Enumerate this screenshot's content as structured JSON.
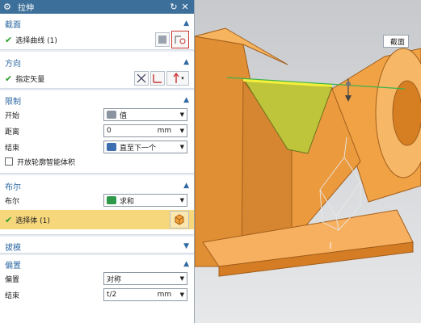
{
  "dialog": {
    "title": "拉伸",
    "sections": {
      "section": "截面",
      "direction": "方向",
      "limits": "限制",
      "boolean": "布尔",
      "draft": "拔模",
      "offset": "偏置"
    },
    "section": {
      "select_curve": "选择曲线 (1)"
    },
    "direction": {
      "specify_vector": "指定矢量"
    },
    "limits": {
      "start_label": "开始",
      "start_value": "值",
      "distance_label": "距离",
      "distance_value": "0",
      "distance_unit": "mm",
      "end_label": "结束",
      "end_value": "直至下一个",
      "open_profile": "开放轮廓智能体积"
    },
    "boolean": {
      "label": "布尔",
      "value": "求和",
      "select_body": "选择体 (1)"
    },
    "offset": {
      "offset_label": "偏置",
      "offset_value": "对称",
      "end_label": "结束",
      "end_value": "t/2",
      "end_unit": "mm"
    }
  },
  "viewport": {
    "tag": "截面"
  },
  "colors": {
    "titlebar": "#3c6f99",
    "accent": "#2f6aa3",
    "selection": "#f7d77c",
    "model": "#f5a44a"
  }
}
